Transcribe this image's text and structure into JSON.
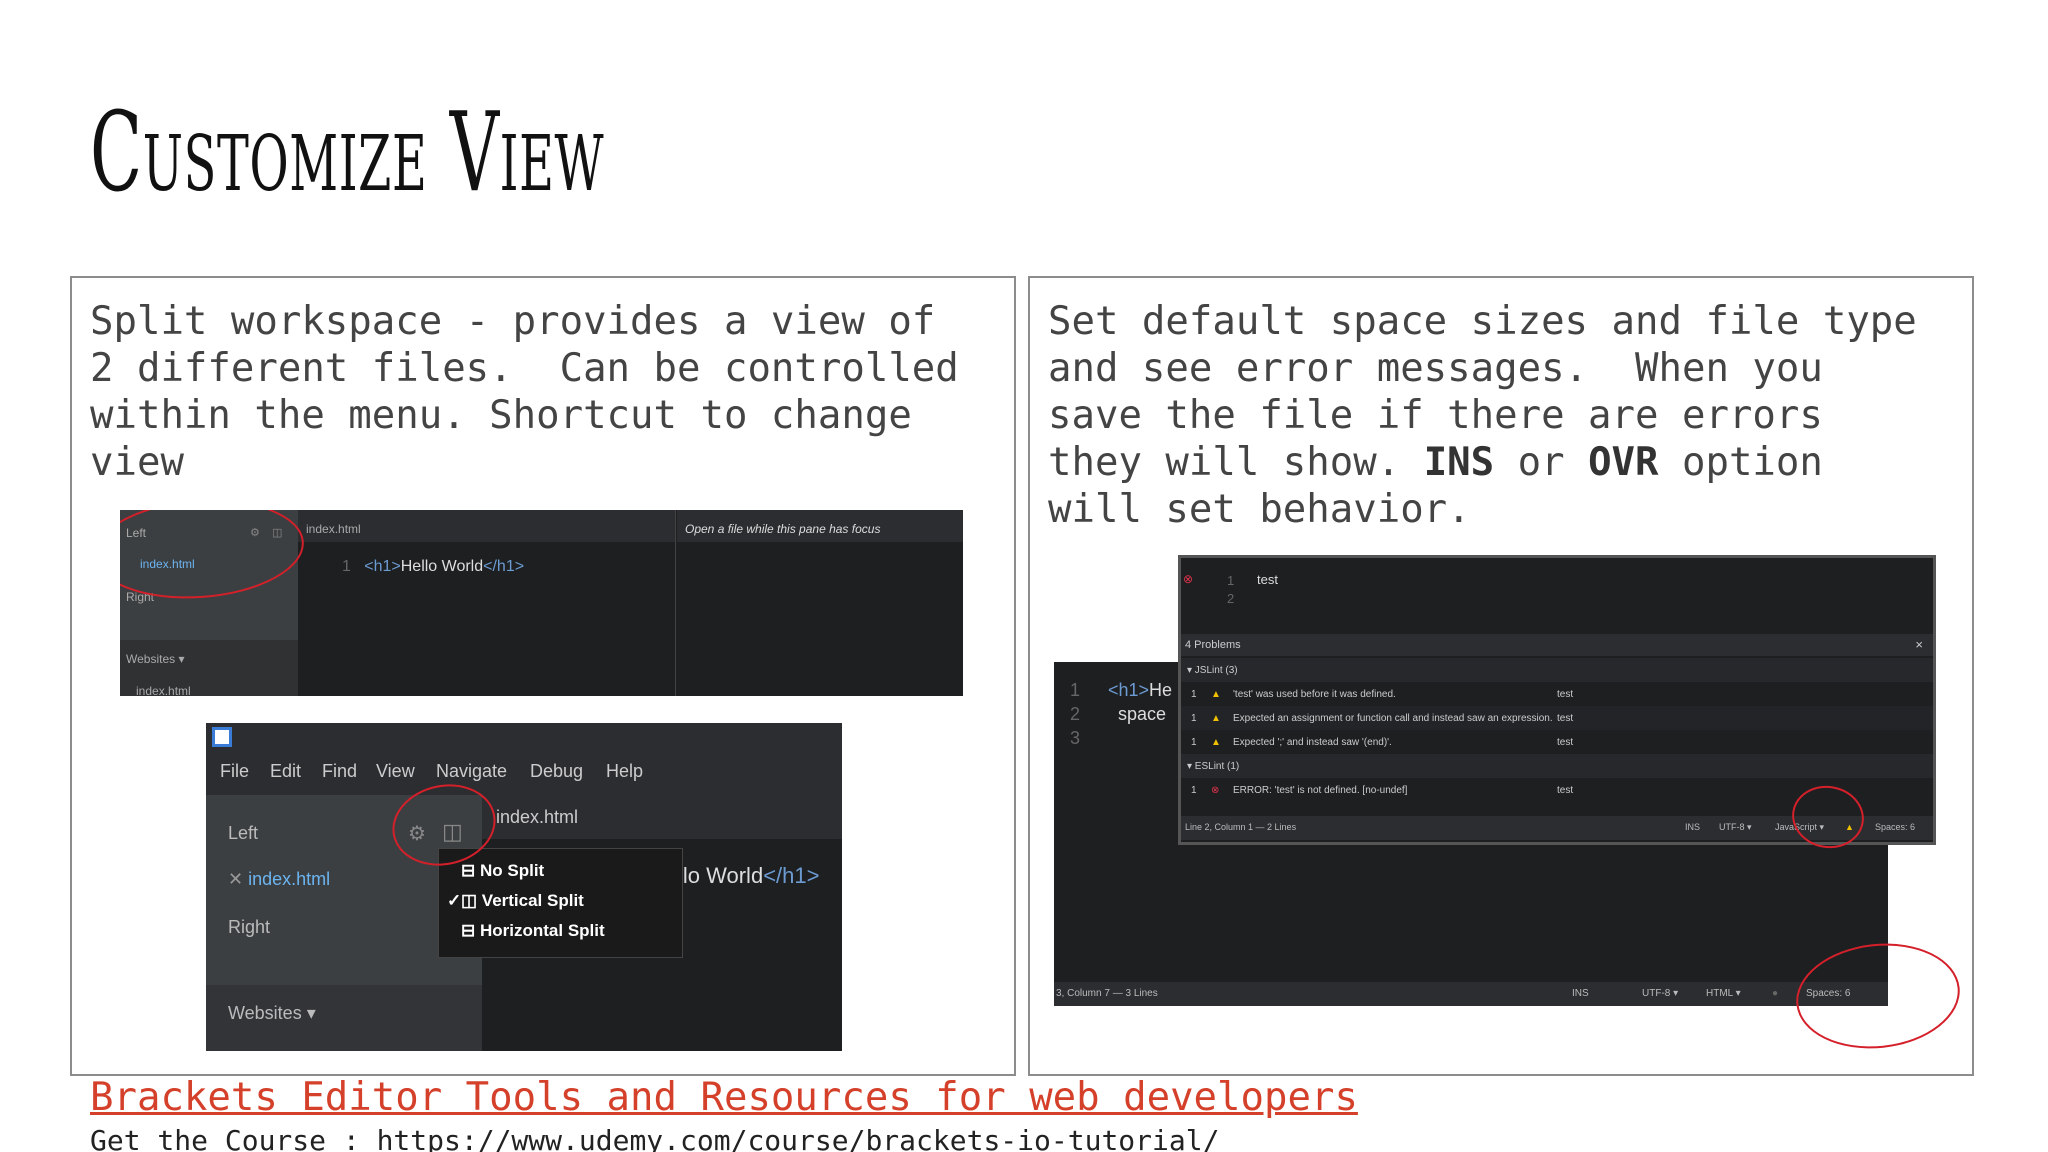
{
  "slide": {
    "title": "Customize View",
    "footer_link": "Brackets Editor Tools and Resources for web developers",
    "footer_course": "Get the Course : https://www.udemy.com/course/brackets-io-tutorial/"
  },
  "left_panel": {
    "text": "Split workspace - provides a view of\n2 different files.  Can be controlled\nwithin the menu. Shortcut to change\nview",
    "shot1": {
      "left_label": "Left",
      "file": "index.html",
      "right_label": "Right",
      "websites": "Websites ▾",
      "websites_file": "index.html",
      "tab1": "index.html",
      "line_num": "1",
      "code_open": "<h1>",
      "code_text": "Hello World",
      "code_close": "</h1>",
      "tab2": "Open a file while this pane has focus"
    },
    "shot2": {
      "menu": [
        "File",
        "Edit",
        "Find",
        "View",
        "Navigate",
        "Debug",
        "Help"
      ],
      "left_label": "Left",
      "file": "index.html",
      "right_label": "Right",
      "websites": "Websites ▾",
      "tab": "index.html",
      "code_fragment": "llo World",
      "code_close": "</h1>",
      "dropdown": [
        {
          "check": "",
          "label": "No Split"
        },
        {
          "check": "✓",
          "label": "Vertical Split"
        },
        {
          "check": "",
          "label": "Horizontal Split"
        }
      ]
    }
  },
  "right_panel": {
    "text_1": "Set default space sizes and file type\nand see error messages.  When you\nsave the file if there are errors\nthey will show. ",
    "ins": "INS",
    "text_or": " or ",
    "ovr": "OVR",
    "text_2": " option\nwill set behavior.",
    "back_shot": {
      "lines": [
        "1",
        "2",
        "3"
      ],
      "code_1": "<h1>He",
      "code_2": "space",
      "status": {
        "position": "3, Column 7 — 3 Lines",
        "ins": "INS",
        "encoding": "UTF-8 ▾",
        "language": "HTML ▾",
        "spaces": "Spaces: 6"
      }
    },
    "front_shot": {
      "lines": [
        "1",
        "2"
      ],
      "code_1": "test",
      "problems_header": "4 Problems",
      "close": "×",
      "jslint": "▾  JSLint (3)",
      "eslint": "▾  ESLint (1)",
      "problems": [
        {
          "line": "1",
          "msg": "'test' was used before it was defined.",
          "src": "test",
          "kind": "warn"
        },
        {
          "line": "1",
          "msg": "Expected an assignment or function call and instead saw an expression.",
          "src": "test",
          "kind": "warn"
        },
        {
          "line": "1",
          "msg": "Expected ';' and instead saw '(end)'.",
          "src": "test",
          "kind": "warn"
        },
        {
          "line": "1",
          "msg": "ERROR: 'test' is not defined. [no-undef]",
          "src": "test",
          "kind": "err"
        }
      ],
      "status": {
        "position": "Line 2, Column 1 — 2 Lines",
        "ins": "INS",
        "encoding": "UTF-8 ▾",
        "language": "JavaScript ▾",
        "spaces": "Spaces: 6"
      }
    }
  }
}
